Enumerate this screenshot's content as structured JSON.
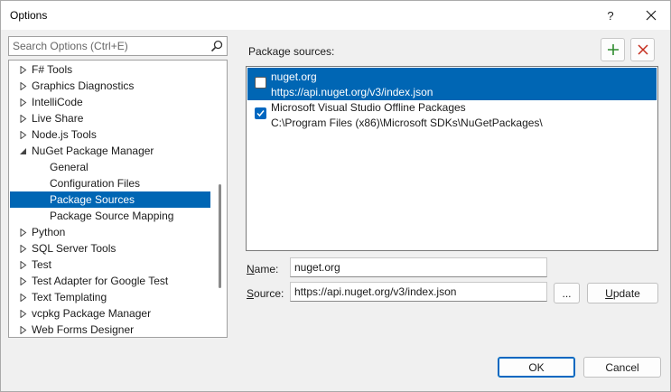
{
  "window": {
    "title": "Options",
    "help_glyph": "?"
  },
  "search": {
    "placeholder": "Search Options (Ctrl+E)"
  },
  "tree": {
    "items": [
      {
        "label": "F# Tools",
        "level": 0,
        "expander": "collapsed"
      },
      {
        "label": "Graphics Diagnostics",
        "level": 0,
        "expander": "collapsed"
      },
      {
        "label": "IntelliCode",
        "level": 0,
        "expander": "collapsed"
      },
      {
        "label": "Live Share",
        "level": 0,
        "expander": "collapsed"
      },
      {
        "label": "Node.js Tools",
        "level": 0,
        "expander": "collapsed"
      },
      {
        "label": "NuGet Package Manager",
        "level": 0,
        "expander": "expanded"
      },
      {
        "label": "General",
        "level": 1
      },
      {
        "label": "Configuration Files",
        "level": 1
      },
      {
        "label": "Package Sources",
        "level": 1,
        "selected": true
      },
      {
        "label": "Package Source Mapping",
        "level": 1
      },
      {
        "label": "Python",
        "level": 0,
        "expander": "collapsed"
      },
      {
        "label": "SQL Server Tools",
        "level": 0,
        "expander": "collapsed"
      },
      {
        "label": "Test",
        "level": 0,
        "expander": "collapsed"
      },
      {
        "label": "Test Adapter for Google Test",
        "level": 0,
        "expander": "collapsed"
      },
      {
        "label": "Text Templating",
        "level": 0,
        "expander": "collapsed"
      },
      {
        "label": "vcpkg Package Manager",
        "level": 0,
        "expander": "collapsed"
      },
      {
        "label": "Web Forms Designer",
        "level": 0,
        "expander": "collapsed"
      }
    ]
  },
  "package_sources": {
    "label": "Package sources:",
    "items": [
      {
        "name": "nuget.org",
        "url": "https://api.nuget.org/v3/index.json",
        "checked": false,
        "selected": true
      },
      {
        "name": "Microsoft Visual Studio Offline Packages",
        "url": "C:\\Program Files (x86)\\Microsoft SDKs\\NuGetPackages\\",
        "checked": true,
        "selected": false
      }
    ]
  },
  "form": {
    "name_label_key": "N",
    "name_label_rest": "ame:",
    "name_value": "nuget.org",
    "source_label_key": "S",
    "source_label_rest": "ource:",
    "source_value": "https://api.nuget.org/v3/index.json",
    "browse_label": "...",
    "update_label_key": "U",
    "update_label_rest": "pdate"
  },
  "footer": {
    "ok_label": "OK",
    "cancel_label": "Cancel"
  },
  "colors": {
    "accent": "#0066b4",
    "add_icon": "#2e8b2e",
    "remove_icon": "#c42b1c"
  },
  "icons": {
    "add": "plus-icon",
    "remove": "x-icon",
    "search": "search-icon",
    "close": "close-icon"
  }
}
